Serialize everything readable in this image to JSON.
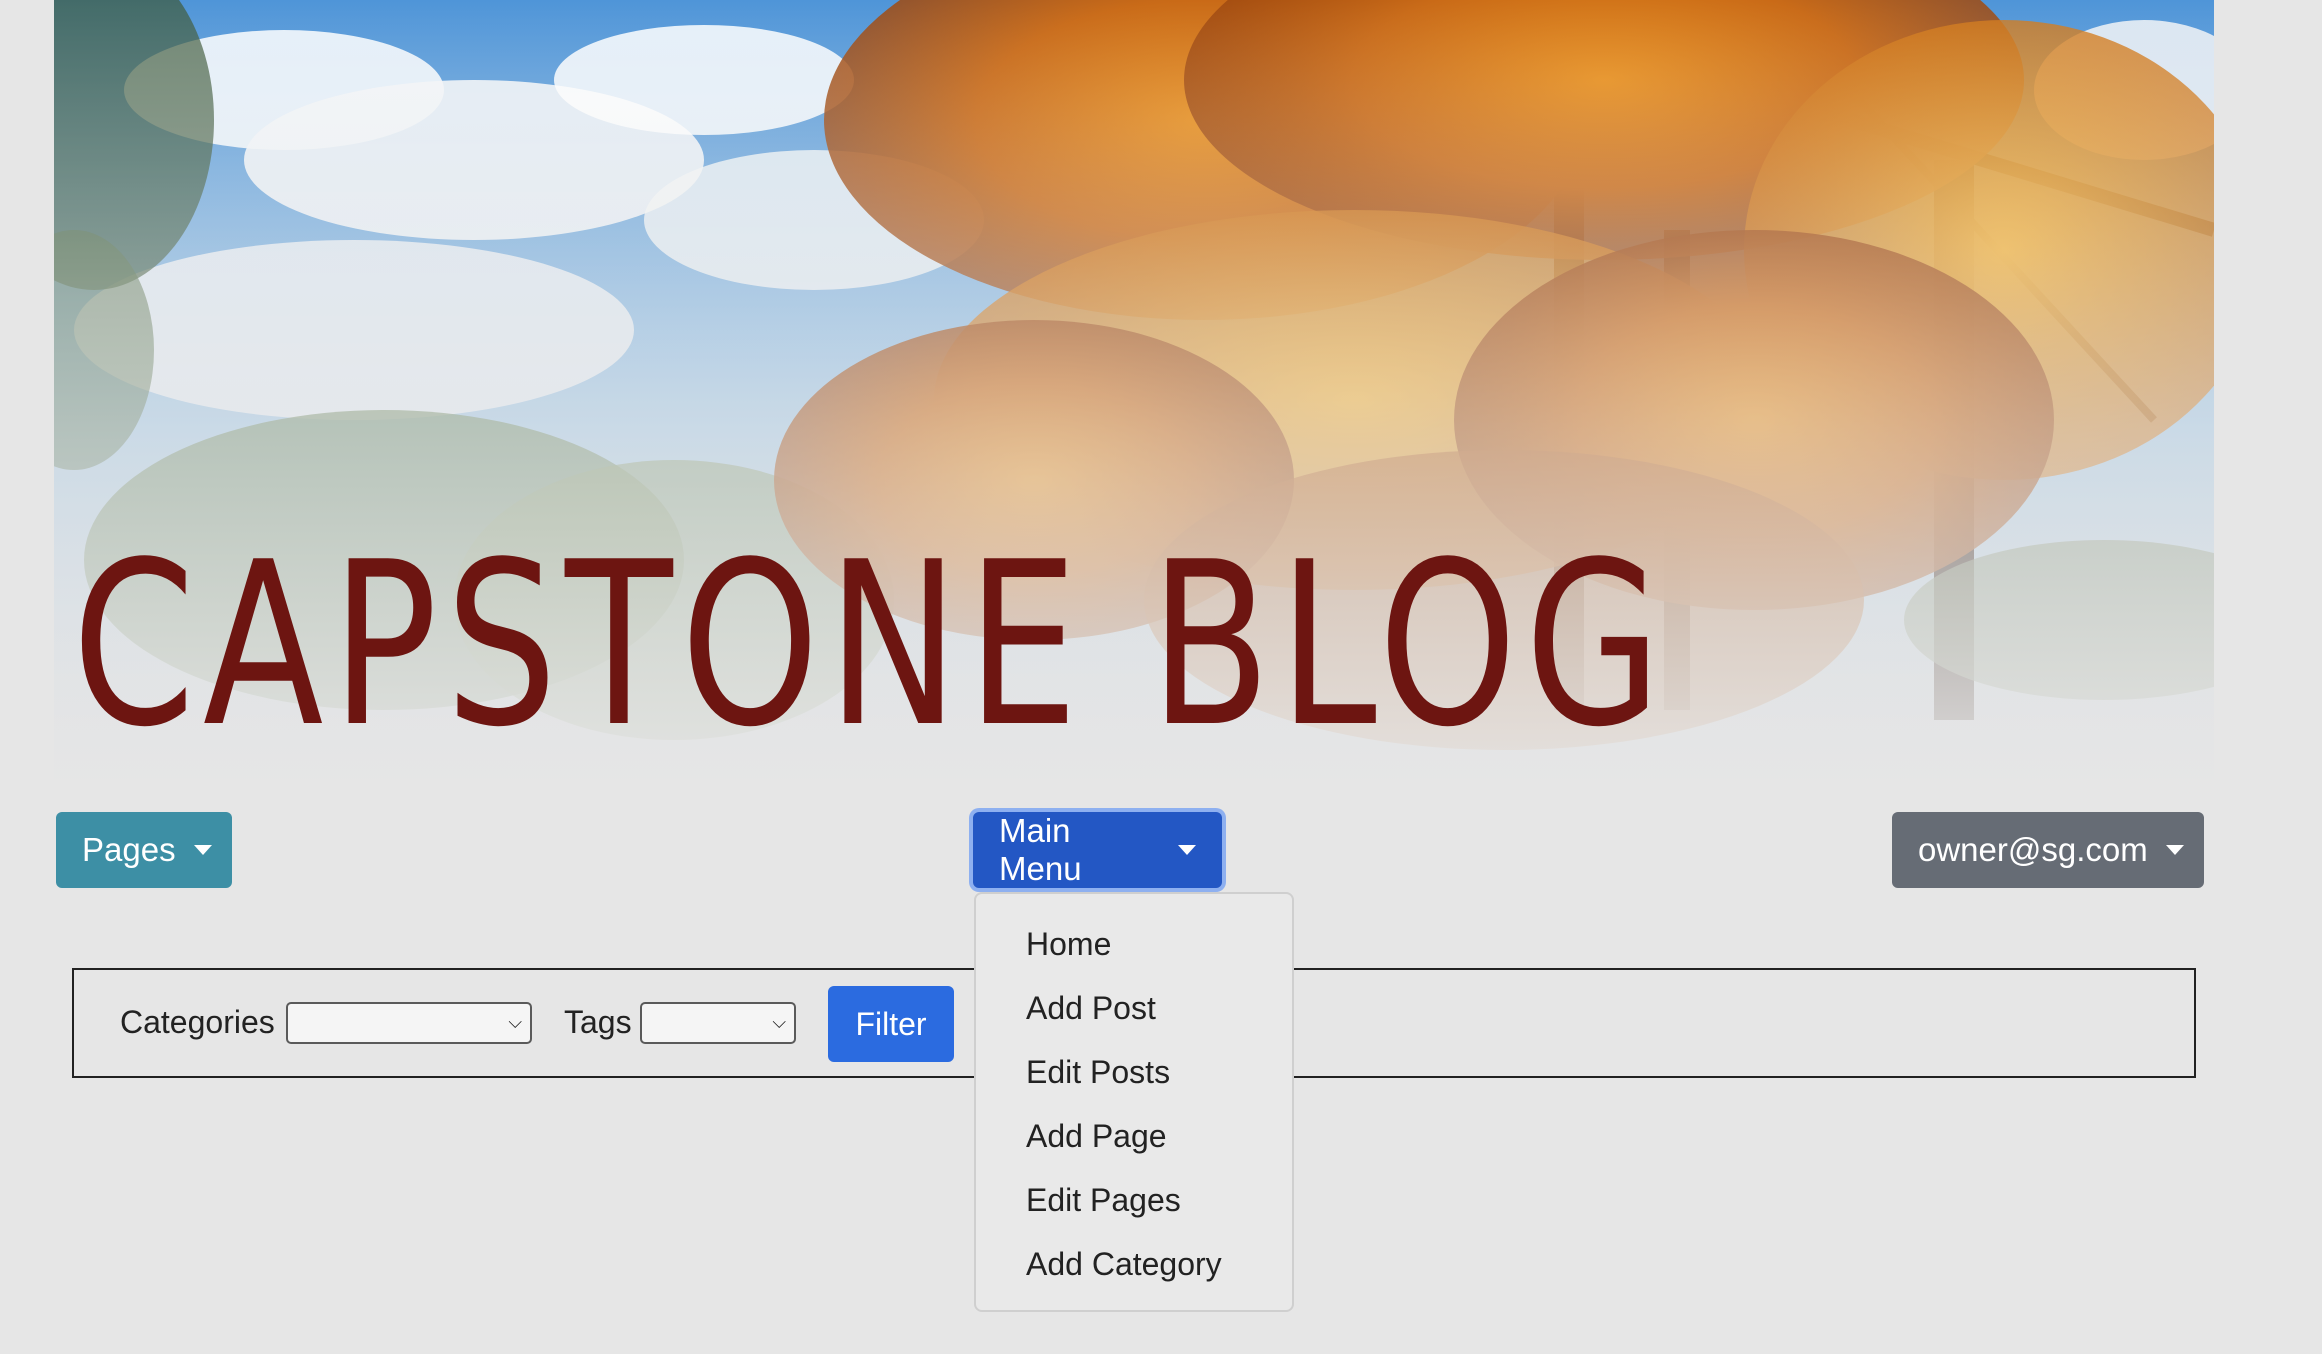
{
  "banner": {
    "title": "CAPSTONE BLOG"
  },
  "nav": {
    "pages_label": "Pages",
    "main_menu_label": "Main Menu",
    "user_label": "owner@sg.com"
  },
  "filter": {
    "categories_label": "Categories",
    "categories_value": "",
    "tags_label": "Tags",
    "tags_value": "",
    "button_label": "Filter"
  },
  "main_menu": {
    "items": [
      {
        "label": "Home"
      },
      {
        "label": "Add Post"
      },
      {
        "label": "Edit Posts"
      },
      {
        "label": "Add Page"
      },
      {
        "label": "Edit Pages"
      },
      {
        "label": "Add Category"
      }
    ]
  },
  "colors": {
    "pages_button": "#3d8fa5",
    "main_menu_button": "#2357c4",
    "user_button": "#666c75",
    "filter_button": "#2b6be0",
    "title_text": "#6d1511"
  }
}
